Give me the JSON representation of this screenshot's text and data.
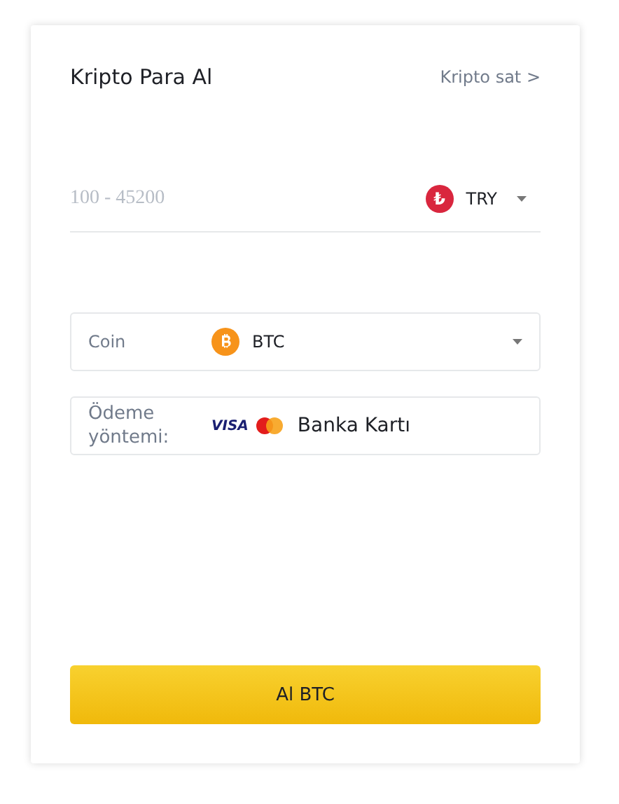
{
  "header": {
    "title": "Kripto Para Al",
    "link": "Kripto sat >"
  },
  "amount": {
    "placeholder": "100 - 45200",
    "currency_symbol": "₺",
    "currency": "TRY"
  },
  "coin": {
    "label": "Coin",
    "value": "BTC"
  },
  "payment": {
    "label": "Ödeme yöntemi:",
    "card_brand": "VISA",
    "value": "Banka Kartı"
  },
  "buy_button": "Al BTC"
}
